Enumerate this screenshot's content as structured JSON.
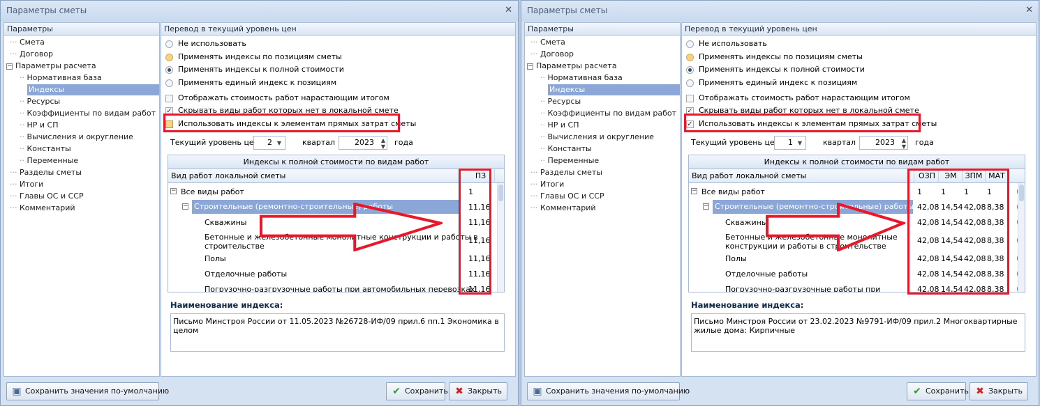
{
  "dialog_title": "Параметры сметы",
  "close_label": "✕",
  "tree_header": "Параметры",
  "tree": {
    "smeta": "Смета",
    "dogovor": "Договор",
    "params": "Параметры расчета",
    "normbase": "Нормативная база",
    "indexes": "Индексы",
    "resources": "Ресурсы",
    "coeffs": "Коэффициенты по видам работ",
    "nr_sp": "НР и СП",
    "calc": "Вычисления и округление",
    "const": "Константы",
    "vars": "Переменные",
    "sections": "Разделы сметы",
    "totals": "Итоги",
    "chapters": "Главы ОС и ССР",
    "comment": "Комментарий"
  },
  "right_header": "Перевод в текущий уровень цен",
  "options": {
    "not_use": "Не использовать",
    "by_position": "Применять индексы по позициям сметы",
    "full_cost": "Применять индексы к полной стоимости",
    "single": "Применять единый индекс к позициям",
    "cumulative": "Отображать стоимость работ нарастающим итогом",
    "hide_missing": "Скрывать виды работ которых нет в локальной смете",
    "direct": "Использовать индексы к элементам прямых затрат сметы"
  },
  "level": {
    "label": "Текущий уровень цен",
    "quarter_label": "квартал",
    "year_label": "года"
  },
  "grid_title": "Индексы к полной стоимости по видам работ",
  "grid_col_name": "Вид работ локальной сметы",
  "idx_label": "Наименование индекса:",
  "buttons": {
    "save_default": "Сохранить значения по-умолчанию",
    "save": "Сохранить",
    "close": "Закрыть"
  },
  "left": {
    "quarter": "2",
    "year": "2023",
    "columns": [
      "ПЗ"
    ],
    "rows": [
      {
        "name": "Все виды работ",
        "vals": [
          "1"
        ]
      },
      {
        "name": "Строительные (ремонтно-строительные) работы",
        "vals": [
          "11,16"
        ]
      },
      {
        "name": "Скважины",
        "vals": [
          "11,16"
        ]
      },
      {
        "name": "Бетонные и железобетонные монолитные конструкции и работы в",
        "name2": "строительстве",
        "vals": [
          "11,16"
        ]
      },
      {
        "name": "Полы",
        "vals": [
          "11,16"
        ]
      },
      {
        "name": "Отделочные работы",
        "vals": [
          "11,16"
        ]
      },
      {
        "name": "Погрузочно-разгрузочные работы при автомобильных перевозках",
        "vals": [
          "11,16"
        ]
      }
    ],
    "idx_text": "Письмо Минстроя России от 11.05.2023 №26728-ИФ/09 прил.6 пп.1 Экономика в целом"
  },
  "right": {
    "quarter": "1",
    "year": "2023",
    "columns": [
      "ОЗП",
      "ЭМ",
      "ЗПМ",
      "МАТ"
    ],
    "rows": [
      {
        "name": "Все виды работ",
        "vals": [
          "1",
          "1",
          "1",
          "1"
        ]
      },
      {
        "name": "Строительные (ремонтно-строительные) работы",
        "vals": [
          "42,08",
          "14,54",
          "42,08",
          "8,38"
        ]
      },
      {
        "name": "Скважины",
        "vals": [
          "42,08",
          "14,54",
          "42,08",
          "8,38"
        ]
      },
      {
        "name": "Бетонные и железобетонные монолитные",
        "name2": "конструкции и работы в строительстве",
        "vals": [
          "42,08",
          "14,54",
          "42,08",
          "8,38"
        ]
      },
      {
        "name": "Полы",
        "vals": [
          "42,08",
          "14,54",
          "42,08",
          "8,38"
        ]
      },
      {
        "name": "Отделочные работы",
        "vals": [
          "42,08",
          "14,54",
          "42,08",
          "8,38"
        ]
      },
      {
        "name": "Погрузочно-разгрузочные работы при",
        "vals": [
          "42,08",
          "14,54",
          "42,08",
          "8,38"
        ]
      }
    ],
    "idx_text": "Письмо Минстроя России от 23.02.2023 №9791-ИФ/09 прил.2 Многоквартирные жилые дома: Кирпичные"
  }
}
